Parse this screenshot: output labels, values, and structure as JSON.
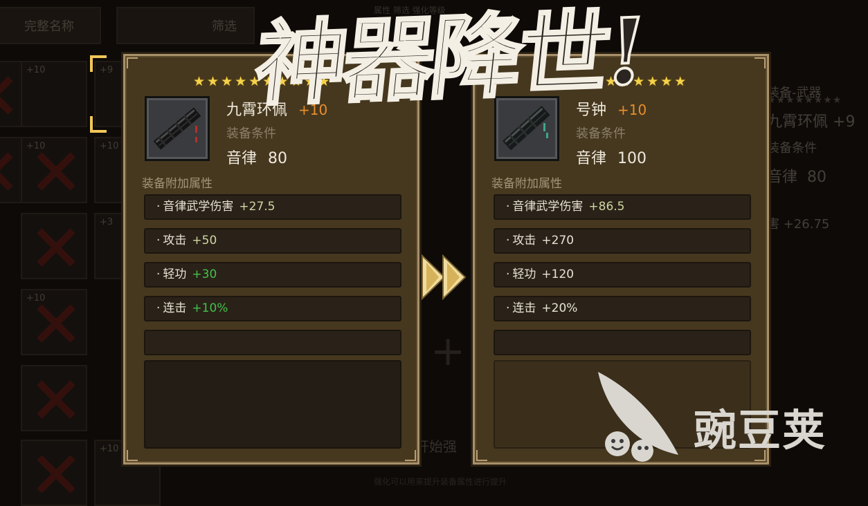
{
  "title": "神器降世!",
  "background": {
    "top_buttons": [
      "完整名称",
      "筛选"
    ],
    "top_text": "属性  筛选  强化等级",
    "slot_levels": [
      "+10",
      "+9",
      "+10",
      "+10",
      "+3",
      "+10",
      "+10"
    ],
    "right_partial": {
      "category": "装备-武器",
      "name": "九霄环佩",
      "plus": "+9",
      "condition": "装备条件",
      "req_label": "音律",
      "req_value": "80",
      "stat_label": "害",
      "stat_value": "+26.75"
    },
    "start_button": "开始强",
    "bottom_hint": "强化可以用来提升装备属性进行提升"
  },
  "left_card": {
    "stars": 10,
    "name": "九霄环佩",
    "plus": "+10",
    "condition_label": "装备条件",
    "req_label": "音律",
    "req_value": "80",
    "attr_title": "装备附加属性",
    "stats": [
      {
        "label": "音律武学伤害",
        "value": "+27.5",
        "color": "gold"
      },
      {
        "label": "攻击",
        "value": "+50",
        "color": "gold"
      },
      {
        "label": "轻功",
        "value": "+30",
        "color": "green"
      },
      {
        "label": "连击",
        "value": "+10%",
        "color": "green"
      }
    ]
  },
  "right_card": {
    "stars": 7,
    "name": "号钟",
    "plus": "+10",
    "condition_label": "装备条件",
    "req_label": "音律",
    "req_value": "100",
    "attr_title": "装备附加属性",
    "stats": [
      {
        "label": "音律武学伤害",
        "value": "+86.5",
        "color": "gold"
      },
      {
        "label": "攻击",
        "value": "+270",
        "color": "white"
      },
      {
        "label": "轻功",
        "value": "+120",
        "color": "white"
      },
      {
        "label": "连击",
        "value": "+20%",
        "color": "white"
      }
    ]
  },
  "watermark": {
    "text": "豌豆荚",
    "icon": "pea-pod-logo"
  },
  "colors": {
    "star": "#f4d24a",
    "plus": "#e98e2a",
    "green_stat": "#42c24a",
    "card_bg": "#46381f"
  }
}
